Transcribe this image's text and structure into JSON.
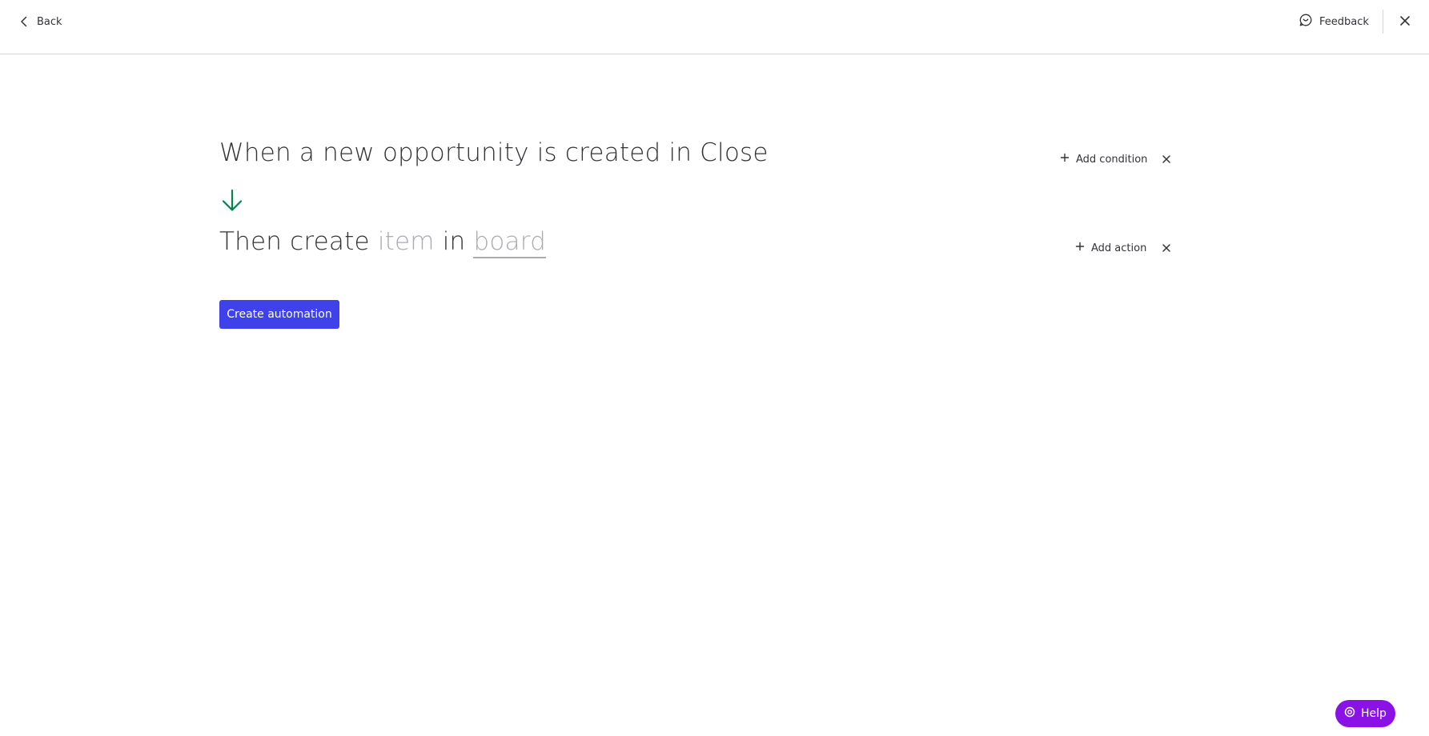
{
  "topbar": {
    "back_label": "Back",
    "feedback_label": "Feedback"
  },
  "trigger": {
    "sentence": "When a new opportunity is created in Close",
    "add_label": "Add condition"
  },
  "action": {
    "prefix": "Then create",
    "item_placeholder": "item",
    "connector": "in",
    "board_placeholder": "board",
    "add_label": "Add action"
  },
  "primary_button": {
    "label": "Create automation"
  },
  "help": {
    "label": "Help"
  },
  "colors": {
    "primary": "#3f42ea",
    "arrow": "#00854d",
    "help": "#8a12e6",
    "placeholder": "#a9abb8"
  },
  "icons": [
    "chevron-left-icon",
    "feedback-icon",
    "close-icon",
    "arrow-down-icon",
    "plus-icon",
    "help-icon"
  ]
}
